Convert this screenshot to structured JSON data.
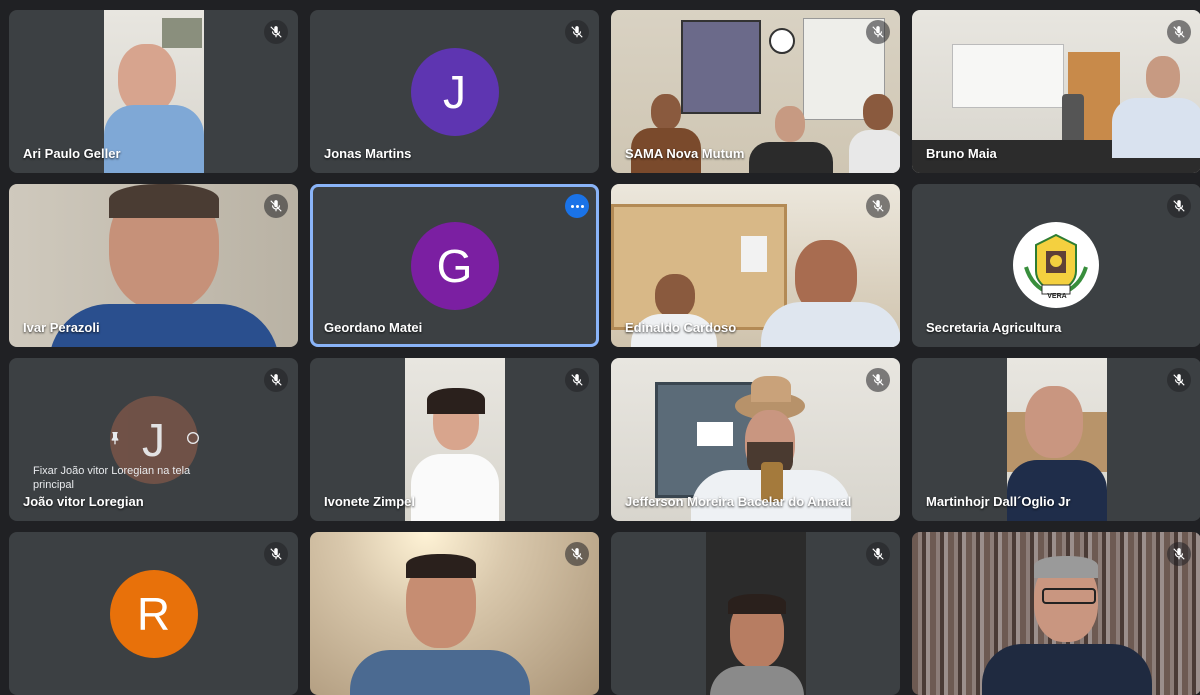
{
  "participants": [
    {
      "name": "Ari Paulo Geller",
      "type": "video",
      "muted": true
    },
    {
      "name": "Jonas Martins",
      "type": "avatar",
      "initial": "J",
      "avatar_color": "#5e35b1",
      "muted": true
    },
    {
      "name": "SAMA Nova Mutum",
      "type": "video",
      "muted": true
    },
    {
      "name": "Bruno Maia",
      "type": "video",
      "muted": true
    },
    {
      "name": "Ivar Perazoli",
      "type": "video",
      "muted": true
    },
    {
      "name": "Geordano Matei",
      "type": "avatar",
      "initial": "G",
      "avatar_color": "#7b1fa2",
      "muted": false,
      "active_speaker": true
    },
    {
      "name": "Edinaldo Cardoso",
      "type": "video",
      "muted": true
    },
    {
      "name": "Secretaria Agricultura",
      "type": "logo",
      "logo_text": "VERA",
      "muted": true
    },
    {
      "name": "João vitor Loregian",
      "type": "avatar",
      "initial": "J",
      "avatar_color": "#795548",
      "muted": true,
      "hover_text": "Fixar João vitor Loregian na tela principal"
    },
    {
      "name": "Ivonete Zimpel",
      "type": "video",
      "muted": true
    },
    {
      "name": "Jefferson Moreira Bacelar do Amaral",
      "type": "video",
      "muted": true
    },
    {
      "name": "Martinhojr Dall´Oglio Jr",
      "type": "video",
      "muted": true
    },
    {
      "name": "",
      "type": "avatar",
      "initial": "R",
      "avatar_color": "#e8710a",
      "muted": true
    },
    {
      "name": "",
      "type": "video",
      "muted": true
    },
    {
      "name": "",
      "type": "video",
      "muted": true
    },
    {
      "name": "",
      "type": "video",
      "muted": true
    }
  ],
  "icons": {
    "muted": "mic-off-icon",
    "more": "more-options-icon",
    "pin": "pin-icon",
    "cast": "cast-icon"
  },
  "colors": {
    "background": "#202124",
    "tile": "#3c4043",
    "active_border": "#8ab4f8",
    "more_button": "#1a73e8"
  }
}
